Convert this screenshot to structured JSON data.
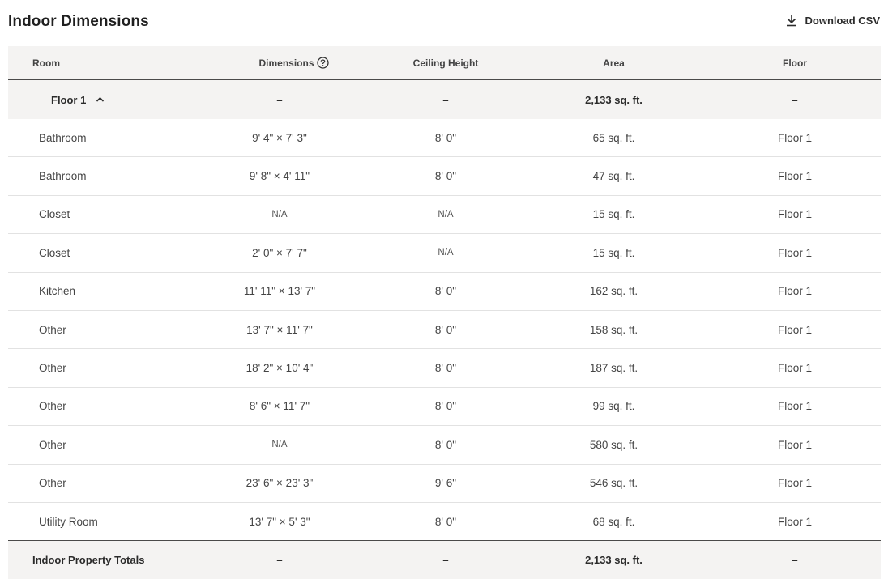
{
  "header": {
    "title": "Indoor Dimensions",
    "download_label": "Download CSV"
  },
  "columns": {
    "room": "Room",
    "dimensions": "Dimensions",
    "ceiling": "Ceiling Height",
    "area": "Area",
    "floor": "Floor"
  },
  "group": {
    "label": "Floor 1",
    "dimensions": "–",
    "ceiling": "–",
    "area": "2,133 sq. ft.",
    "floor": "–"
  },
  "rows": [
    {
      "room": "Bathroom",
      "dimensions": "9' 4\" × 7' 3\"",
      "ceiling": "8' 0\"",
      "area": "65 sq. ft.",
      "floor": "Floor 1"
    },
    {
      "room": "Bathroom",
      "dimensions": "9' 8\" × 4' 11\"",
      "ceiling": "8' 0\"",
      "area": "47 sq. ft.",
      "floor": "Floor 1"
    },
    {
      "room": "Closet",
      "dimensions": "N/A",
      "ceiling": "N/A",
      "area": "15 sq. ft.",
      "floor": "Floor 1"
    },
    {
      "room": "Closet",
      "dimensions": "2' 0\" × 7' 7\"",
      "ceiling": "N/A",
      "area": "15 sq. ft.",
      "floor": "Floor 1"
    },
    {
      "room": "Kitchen",
      "dimensions": "11' 11\" × 13' 7\"",
      "ceiling": "8' 0\"",
      "area": "162 sq. ft.",
      "floor": "Floor 1"
    },
    {
      "room": "Other",
      "dimensions": "13' 7\" × 11' 7\"",
      "ceiling": "8' 0\"",
      "area": "158 sq. ft.",
      "floor": "Floor 1"
    },
    {
      "room": "Other",
      "dimensions": "18' 2\" × 10' 4\"",
      "ceiling": "8' 0\"",
      "area": "187 sq. ft.",
      "floor": "Floor 1"
    },
    {
      "room": "Other",
      "dimensions": "8' 6\" × 11' 7\"",
      "ceiling": "8' 0\"",
      "area": "99 sq. ft.",
      "floor": "Floor 1"
    },
    {
      "room": "Other",
      "dimensions": "N/A",
      "ceiling": "8' 0\"",
      "area": "580 sq. ft.",
      "floor": "Floor 1"
    },
    {
      "room": "Other",
      "dimensions": "23' 6\" × 23' 3\"",
      "ceiling": "9' 6\"",
      "area": "546 sq. ft.",
      "floor": "Floor 1"
    },
    {
      "room": "Utility Room",
      "dimensions": "13' 7\" × 5' 3\"",
      "ceiling": "8' 0\"",
      "area": "68 sq. ft.",
      "floor": "Floor 1"
    }
  ],
  "totals": {
    "label": "Indoor Property Totals",
    "dimensions": "–",
    "ceiling": "–",
    "area": "2,133 sq. ft.",
    "floor": "–"
  },
  "icons": {
    "download": "download-icon",
    "help": "help-circle-icon",
    "collapse": "chevron-up-icon"
  }
}
